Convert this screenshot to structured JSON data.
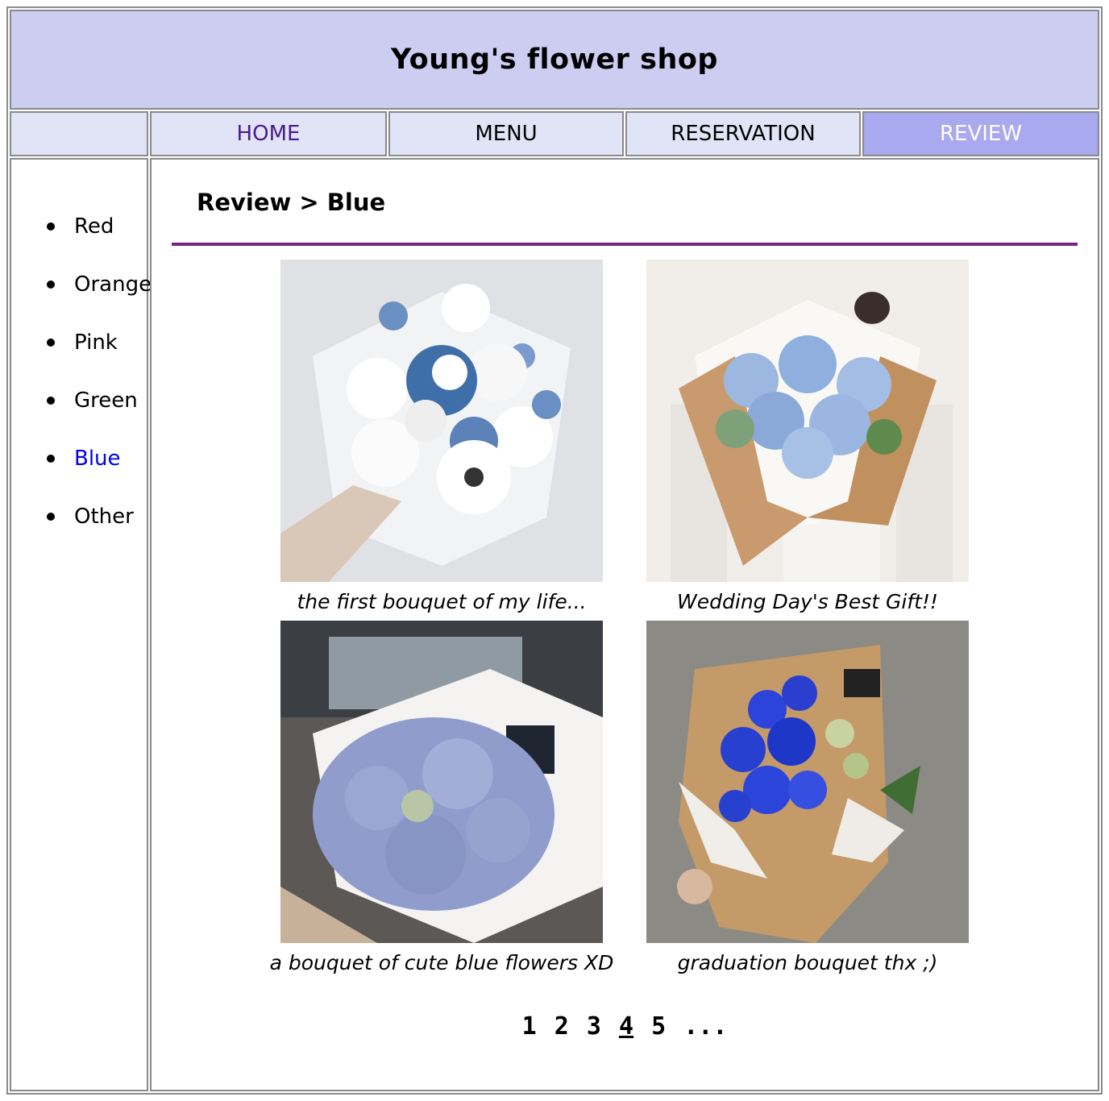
{
  "header": {
    "title": "Young's flower shop"
  },
  "nav": [
    {
      "label": "HOME",
      "color": "#4b1a8a"
    },
    {
      "label": "MENU",
      "color": "#000000"
    },
    {
      "label": "RESERVATION",
      "color": "#000000"
    },
    {
      "label": "REVIEW",
      "color": "#ffffff"
    }
  ],
  "sidebar": {
    "items": [
      {
        "label": "Red"
      },
      {
        "label": "Orange"
      },
      {
        "label": "Pink"
      },
      {
        "label": "Green"
      },
      {
        "label": "Blue",
        "color": "#0000ee"
      },
      {
        "label": "Other"
      }
    ]
  },
  "main": {
    "breadcrumb": "Review > Blue",
    "reviews": [
      {
        "caption": "the first bouquet of my life..."
      },
      {
        "caption": "Wedding Day's Best Gift!!"
      },
      {
        "caption": "a bouquet of cute blue flowers XD"
      },
      {
        "caption": "graduation bouquet thx ;)"
      }
    ],
    "pagination": {
      "pages": [
        "1",
        "2",
        "3",
        "4",
        "5"
      ],
      "current": "4",
      "more": "..."
    }
  },
  "colors": {
    "header_bg": "#cdcdf1",
    "nav_bg": "#e0e4f6",
    "nav_active_bg": "#a9a9ef",
    "rule": "#7b2283"
  }
}
